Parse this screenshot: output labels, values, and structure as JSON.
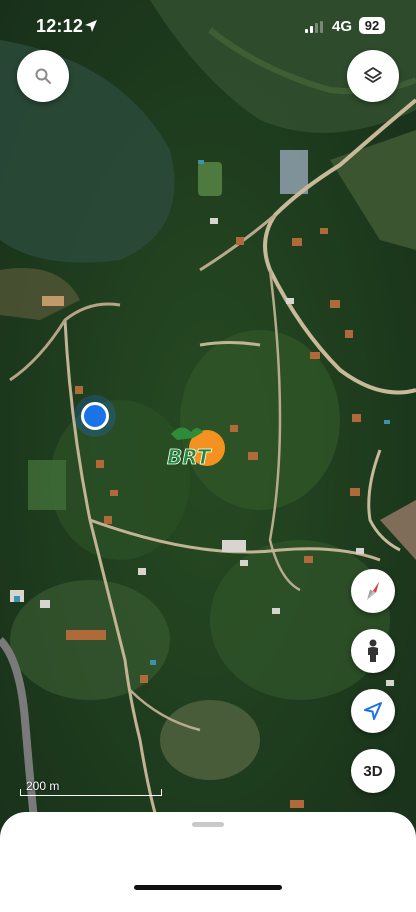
{
  "status_bar": {
    "time": "12:12",
    "network": "4G",
    "battery": "92"
  },
  "map": {
    "type": "satellite",
    "scale_label": "200 m"
  },
  "controls": {
    "three_d_label": "3D"
  },
  "marker": {
    "logo_text": "BRT"
  },
  "colors": {
    "user_location": "#1a73e8",
    "compass_red": "#e53935",
    "locate_blue": "#1a73e8"
  }
}
